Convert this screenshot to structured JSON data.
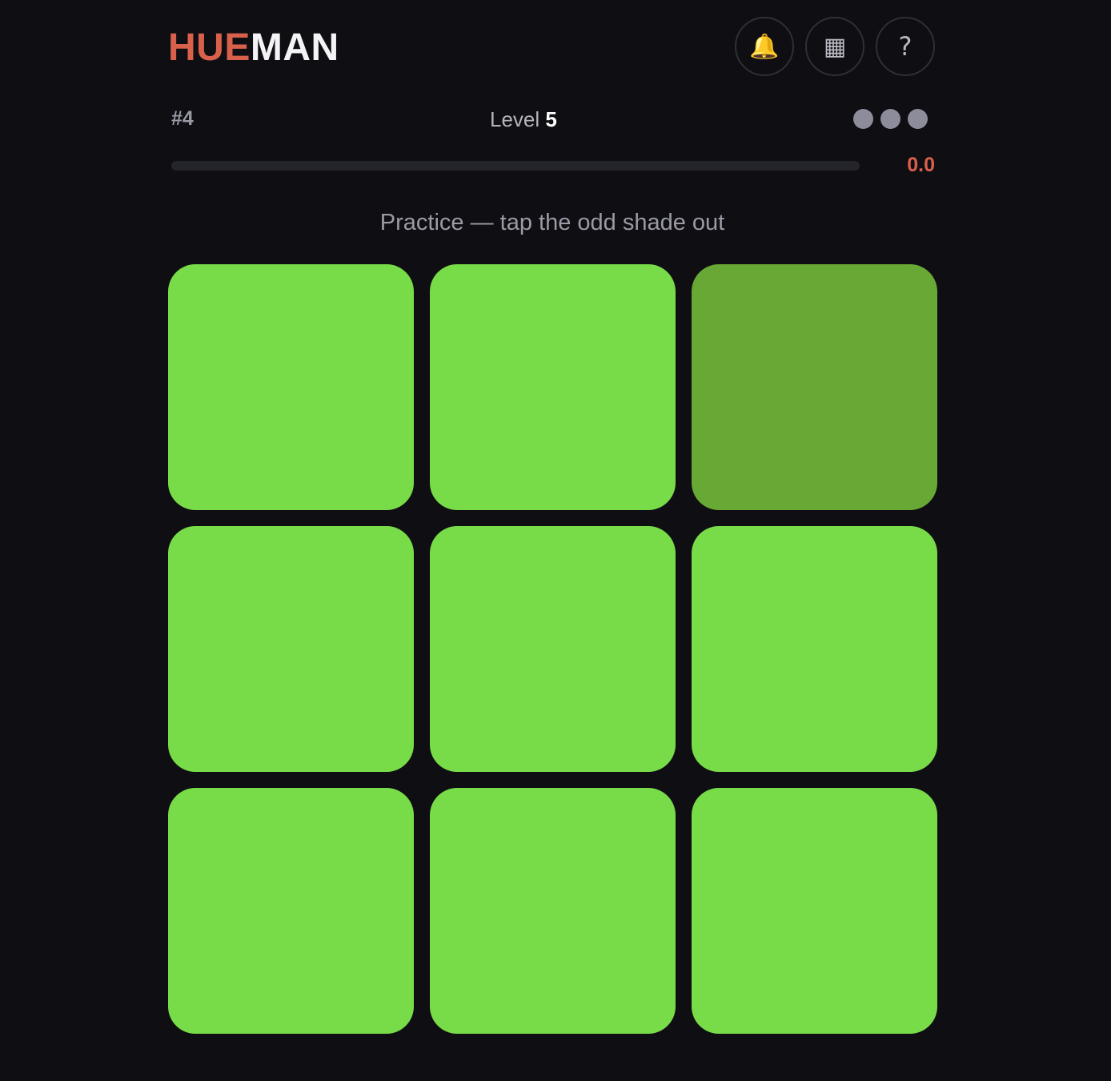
{
  "header": {
    "logo_part1": "HUE",
    "logo_part2": "MAN",
    "buttons": [
      {
        "name": "notifications",
        "icon": "bell-icon",
        "glyph": "🔔"
      },
      {
        "name": "calendar",
        "icon": "calendar-grid-icon",
        "glyph": "▦"
      },
      {
        "name": "help",
        "icon": "question-mark-icon",
        "glyph": "?"
      }
    ]
  },
  "status": {
    "puzzle_number": "#4",
    "level_label": "Level",
    "level_value": "5",
    "lives": 3
  },
  "timer": {
    "value": "0.0",
    "progress": 0
  },
  "instruction": "Practice — tap the odd shade out",
  "grid": {
    "rows": 3,
    "cols": 3,
    "base_color": "#78db48",
    "odd_color": "#68a834",
    "odd_index": 2
  },
  "colors": {
    "accent": "#d9604a",
    "background": "#0e0e13",
    "life_dot": "#8d8c9a"
  }
}
